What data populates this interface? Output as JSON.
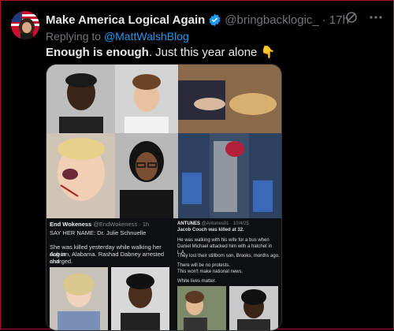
{
  "tweet": {
    "author_name": "Make America Logical Again",
    "handle": "@bringbacklogic_",
    "separator": "·",
    "time": "17h",
    "reply_prefix": "Replying to",
    "reply_mention": "@MattWalshBlog",
    "text_bold": "Enough is enough",
    "text_rest": ". Just this year alone",
    "text_emoji": "👇",
    "icons": [
      "grok-icon",
      "more-icon",
      "verified-badge-icon"
    ],
    "accent_color": "#1d9bf0"
  },
  "embedded_left": {
    "name": "End Wokeness",
    "handle": "@EndWokeness",
    "time": "· 1h",
    "line1": "SAY HER NAME: Dr. Julie Schnuelle",
    "line2": "She was killed yesterday while walking her dog in",
    "line3": "Auburn, Alabama. Rashad Dabney arrested and",
    "line4": "charged."
  },
  "embedded_right": {
    "name": "ANTUNES",
    "handle": "@Antunes01",
    "time": "· 10/4/25",
    "line1": "Jacob Couch was killed at 32.",
    "line2": "He was walking with his wife for a bus when",
    "line3": "Daniel Michael attacked him with a hatchet in L.A.",
    "line4": "They lost their stillborn son, Brooks, months ago.",
    "line5": "There will be no protests.",
    "line6": "This won't make national news.",
    "line7": "White lives matter."
  }
}
